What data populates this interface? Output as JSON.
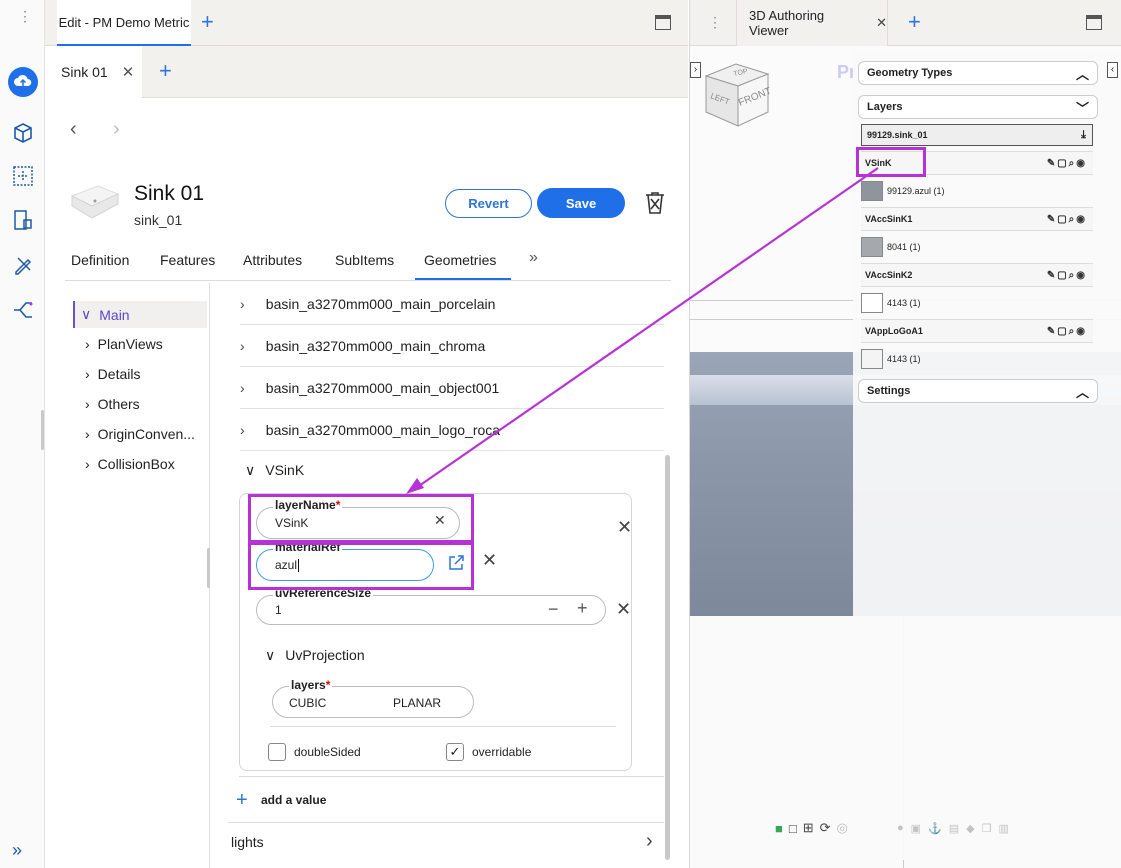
{
  "window_tabs": {
    "editor_tab": "Edit - PM Demo Metric",
    "viewer_tab": "3D Authoring Viewer"
  },
  "editor": {
    "doc_tab": "Sink 01",
    "item": {
      "title": "Sink 01",
      "subtitle": "sink_01"
    },
    "buttons": {
      "revert": "Revert",
      "save": "Save"
    },
    "tabs": [
      "Definition",
      "Features",
      "Attributes",
      "SubItems",
      "Geometries"
    ],
    "active_tab": "Geometries",
    "tree": [
      "Main",
      "PlanViews",
      "Details",
      "Others",
      "OriginConven...",
      "CollisionBox"
    ],
    "geometry_rows": [
      "basin_a3270mm000_main_porcelain",
      "basin_a3270mm000_main_chroma",
      "basin_a3270mm000_main_object001",
      "basin_a3270mm000_main_logo_roca"
    ],
    "expanded": "VSinK",
    "fields": {
      "layerName": {
        "label": "layerName",
        "value": "VSinK"
      },
      "materialRef": {
        "label": "materialRef",
        "value": "azul"
      },
      "uvReferenceSize": {
        "label": "uvReferenceSize",
        "value": "1"
      }
    },
    "uv_projection": {
      "title": "UvProjection",
      "layers_label": "layers",
      "options": [
        "CUBIC",
        "PLANAR"
      ]
    },
    "checkboxes": {
      "doubleSided": "doubleSided",
      "overridable": "overridable"
    },
    "add_value": "add a value",
    "lights": "lights"
  },
  "viewer": {
    "cube": {
      "top": "TOP",
      "left": "LEFT",
      "front": "FRONT"
    },
    "peek_text": "Pr",
    "sections": {
      "geometry_types": "Geometry Types",
      "layers": "Layers",
      "settings": "Settings"
    },
    "file": "99129.sink_01",
    "layers": [
      {
        "name": "VSinK",
        "material": "99129.azul (1)",
        "swatch": "#8f959c"
      },
      {
        "name": "VAccSinK1",
        "material": "8041 (1)",
        "swatch": "#a5a8ad"
      },
      {
        "name": "VAccSinK2",
        "material": "4143 (1)",
        "swatch": "#ffffff"
      },
      {
        "name": "VAppLoGoA1",
        "material": "4143 (1)",
        "swatch": "#f4f4f4"
      }
    ]
  },
  "colors": {
    "accent": "#1f6fe8",
    "highlight": "#b632d6"
  }
}
